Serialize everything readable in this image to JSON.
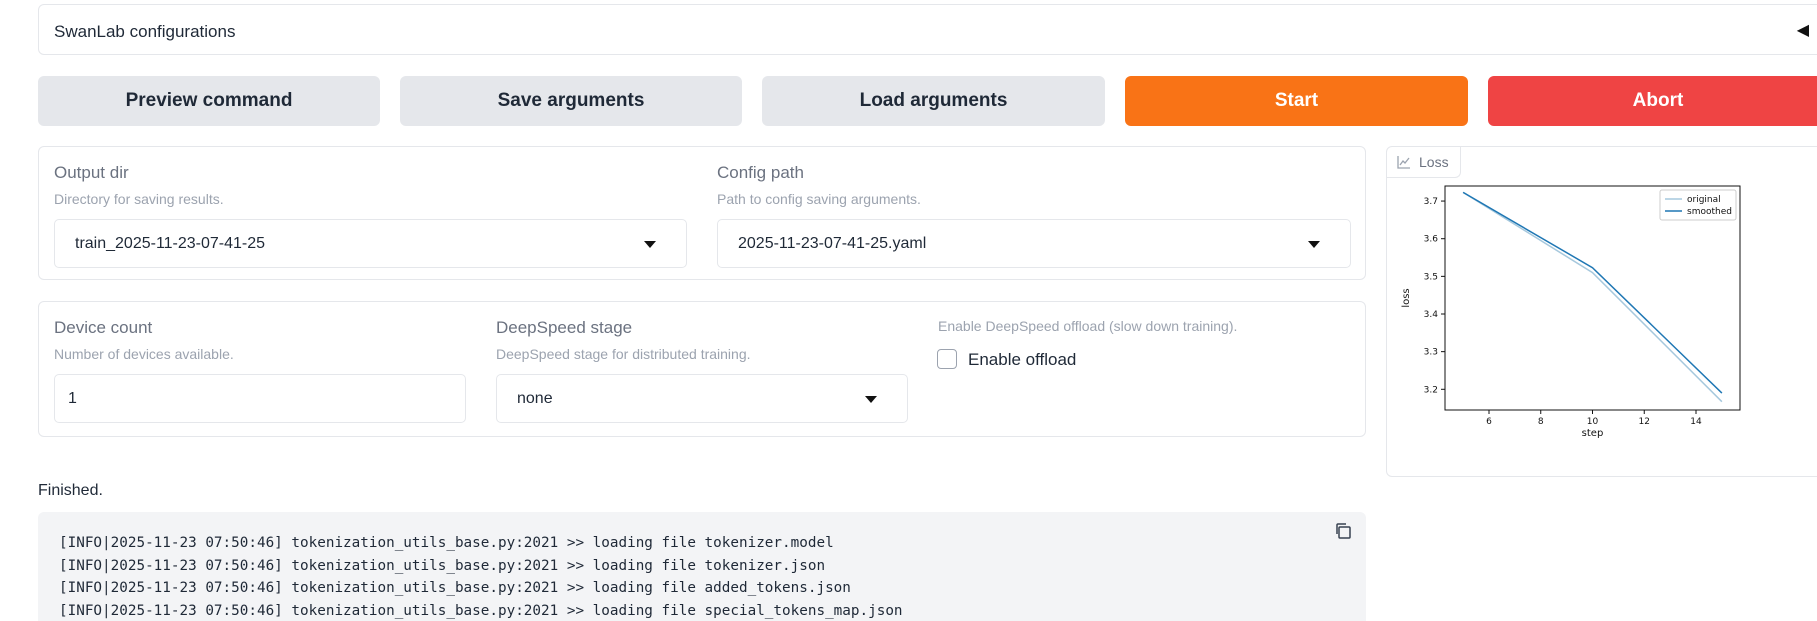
{
  "accordion": {
    "title": "SwanLab configurations",
    "caret": "◀"
  },
  "buttons": {
    "preview": "Preview command",
    "save": "Save arguments",
    "load": "Load arguments",
    "start": "Start",
    "abort": "Abort"
  },
  "output_dir": {
    "label": "Output dir",
    "info": "Directory for saving results.",
    "value": "train_2025-11-23-07-41-25"
  },
  "config_path": {
    "label": "Config path",
    "info": "Path to config saving arguments.",
    "value": "2025-11-23-07-41-25.yaml"
  },
  "device_count": {
    "label": "Device count",
    "info": "Number of devices available.",
    "value": "1"
  },
  "deepspeed_stage": {
    "label": "DeepSpeed stage",
    "info": "DeepSpeed stage for distributed training.",
    "value": "none"
  },
  "offload": {
    "info": "Enable DeepSpeed offload (slow down training).",
    "label": "Enable offload",
    "checked": false
  },
  "plot": {
    "tab_label": "Loss",
    "tab_icon": "chart-icon"
  },
  "chart_data": {
    "type": "line",
    "title": "",
    "xlabel": "step",
    "ylabel": "loss",
    "xlim": [
      4.3,
      15.7
    ],
    "ylim": [
      3.145,
      3.74
    ],
    "xticks": [
      6,
      8,
      10,
      12,
      14
    ],
    "yticks": [
      3.2,
      3.3,
      3.4,
      3.5,
      3.6,
      3.7
    ],
    "legend_position": "top-right",
    "grid": false,
    "series": [
      {
        "name": "original",
        "color": "#a6c8dd",
        "x": [
          5,
          10,
          15
        ],
        "y": [
          3.723,
          3.51,
          3.167
        ]
      },
      {
        "name": "smoothed",
        "color": "#1f77b4",
        "x": [
          5,
          10,
          15
        ],
        "y": [
          3.723,
          3.523,
          3.19
        ]
      }
    ]
  },
  "status": "Finished.",
  "log": {
    "lines": [
      "[INFO|2025-11-23 07:50:46] tokenization_utils_base.py:2021 >> loading file tokenizer.model",
      "[INFO|2025-11-23 07:50:46] tokenization_utils_base.py:2021 >> loading file tokenizer.json",
      "[INFO|2025-11-23 07:50:46] tokenization_utils_base.py:2021 >> loading file added_tokens.json",
      "[INFO|2025-11-23 07:50:46] tokenization_utils_base.py:2021 >> loading file special_tokens_map.json"
    ]
  },
  "colors": {
    "primary": "#f97316",
    "stop": "#ef4444",
    "secondary": "#e5e7eb"
  }
}
